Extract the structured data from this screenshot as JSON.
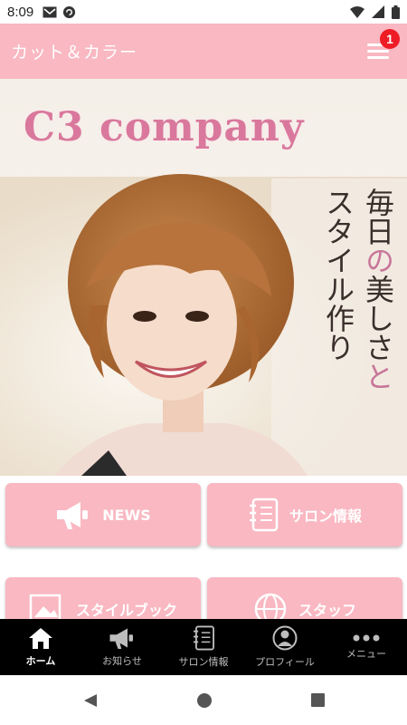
{
  "status_bar": {
    "time": "8:09"
  },
  "app_bar": {
    "title": "カット＆カラー",
    "badge_count": "1"
  },
  "hero": {
    "logo_text": "C3 company",
    "tagline_right": "毎日の美しさと",
    "tagline_left": "スタイル作り"
  },
  "tiles": [
    {
      "label": "NEWS",
      "icon": "megaphone-icon"
    },
    {
      "label": "サロン情報",
      "icon": "notebook-icon"
    },
    {
      "label": "スタイルブック",
      "icon": "photo-icon"
    },
    {
      "label": "スタッフ",
      "icon": "globe-icon"
    }
  ],
  "bottom_nav": [
    {
      "label": "ホーム",
      "icon": "home-icon"
    },
    {
      "label": "お知らせ",
      "icon": "megaphone-icon"
    },
    {
      "label": "サロン情報",
      "icon": "notebook-icon"
    },
    {
      "label": "プロフィール",
      "icon": "profile-icon"
    },
    {
      "label": "メニュー",
      "icon": "more-icon"
    }
  ],
  "colors": {
    "accent": "#f9b8c2",
    "badge": "#ee1c25",
    "logo": "#d9789c"
  }
}
